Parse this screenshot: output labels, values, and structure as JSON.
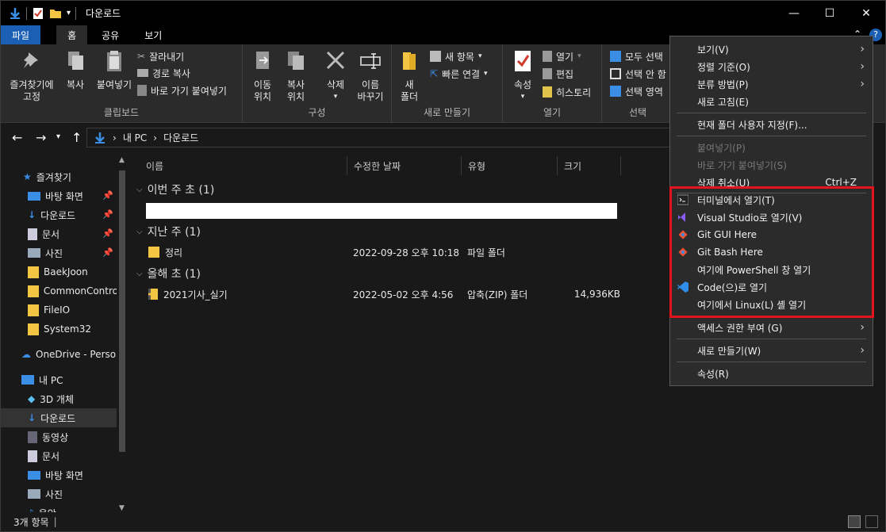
{
  "window": {
    "title": "다운로드"
  },
  "ribbon_tabs": [
    "파일",
    "홈",
    "공유",
    "보기"
  ],
  "ribbon": {
    "clipboard": {
      "pin_label": [
        "즐겨찾기에",
        "고정"
      ],
      "copy_label": "복사",
      "paste_label": "붙여넣기",
      "cut_label": "잘라내기",
      "copy_path_label": "경로 복사",
      "paste_shortcut_label": "바로 가기 붙여넣기",
      "group_label": "클립보드"
    },
    "organize": {
      "move_to_label": [
        "이동",
        "위치"
      ],
      "copy_to_label": [
        "복사",
        "위치"
      ],
      "delete_label": "삭제",
      "rename_label": [
        "이름",
        "바꾸기"
      ],
      "group_label": "구성"
    },
    "new": {
      "new_folder_label": [
        "새",
        "폴더"
      ],
      "new_item_label": "새 항목",
      "easy_access_label": "빠른 연결",
      "group_label": "새로 만들기"
    },
    "open": {
      "properties_label": "속성",
      "open_label": "열기",
      "edit_label": "편집",
      "history_label": "히스토리",
      "group_label": "열기"
    },
    "select": {
      "select_all_label": "모두 선택",
      "select_none_label": "선택 안 함",
      "invert_label": "선택 영역",
      "group_label": "선택"
    }
  },
  "breadcrumb": [
    "내 PC",
    "다운로드"
  ],
  "sidebar": {
    "quick_access": "즐겨찾기",
    "items": [
      {
        "label": "바탕 화면",
        "pinned": true
      },
      {
        "label": "다운로드",
        "pinned": true
      },
      {
        "label": "문서",
        "pinned": true
      },
      {
        "label": "사진",
        "pinned": true
      },
      {
        "label": "BaekJoon",
        "pinned": false
      },
      {
        "label": "CommonContro",
        "pinned": false
      },
      {
        "label": "FileIO",
        "pinned": false
      },
      {
        "label": "System32",
        "pinned": false
      }
    ],
    "onedrive": "OneDrive - Persor",
    "this_pc": "내 PC",
    "pc_items": [
      "3D 개체",
      "다운로드",
      "동영상",
      "문서",
      "바탕 화면",
      "사진",
      "음악"
    ]
  },
  "columns": [
    "이름",
    "수정한 날짜",
    "유형",
    "크기"
  ],
  "groups": [
    {
      "header": "이번 주 초 (1)"
    },
    {
      "header": "지난 주 (1)",
      "row": {
        "name": "정리",
        "date": "2022-09-28 오후 10:18",
        "type": "파일 폴더",
        "size": ""
      }
    },
    {
      "header": "올해 초 (1)",
      "row": {
        "name": "2021기사_실기",
        "date": "2022-05-02 오후 4:56",
        "type": "압축(ZIP) 폴더",
        "size": "14,936KB"
      }
    }
  ],
  "status": {
    "text": "3개 항목"
  },
  "context_menu": [
    {
      "label": "보기(V)",
      "arrow": true
    },
    {
      "label": "정렬 기준(O)",
      "arrow": true
    },
    {
      "label": "분류 방법(P)",
      "arrow": true
    },
    {
      "label": "새로 고침(E)"
    },
    {
      "label": "현재 폴더 사용자 지정(F)..."
    },
    {
      "label": "붙여넣기(P)",
      "disabled": true
    },
    {
      "label": "바로 가기 붙여넣기(S)",
      "disabled": true
    },
    {
      "label": "삭제 취소(U)",
      "shortcut": "Ctrl+Z"
    },
    {
      "label": "터미널에서 열기(T)",
      "icon": "terminal-icon"
    },
    {
      "label": "Visual Studio로 열기(V)",
      "icon": "visual-studio-icon"
    },
    {
      "label": "Git GUI Here",
      "icon": "git-icon"
    },
    {
      "label": "Git Bash Here",
      "icon": "git-icon"
    },
    {
      "label": "여기에 PowerShell 창 열기"
    },
    {
      "label": "Code(으)로 열기",
      "icon": "vscode-icon"
    },
    {
      "label": "여기에서 Linux(L) 셸 열기"
    },
    {
      "label": "액세스 권한 부여 (G)",
      "arrow": true
    },
    {
      "label": "새로 만들기(W)",
      "arrow": true
    },
    {
      "label": "속성(R)"
    }
  ],
  "colors": {
    "accent": "#1a5fb4",
    "highlight": "#e3141e",
    "folder": "#f4c542"
  }
}
